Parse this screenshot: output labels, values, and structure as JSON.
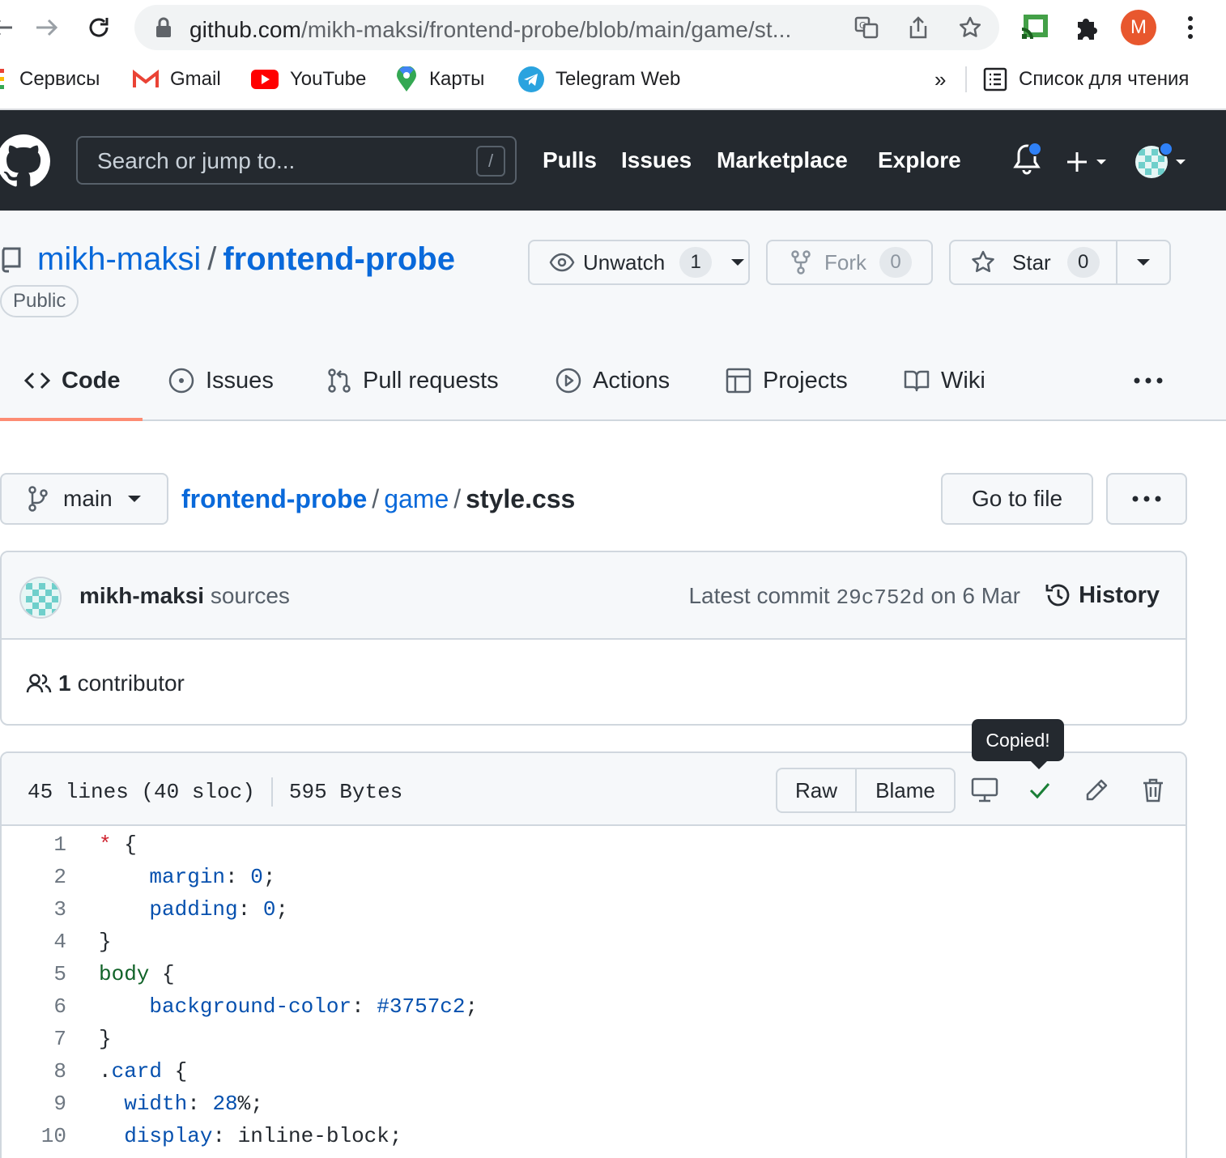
{
  "browser": {
    "url_host": "github.com",
    "url_path": "/mikh-maksi/frontend-probe/blob/main/game/st...",
    "profile_initial": "M",
    "bookmarks": [
      {
        "label": "Сервисы"
      },
      {
        "label": "Gmail"
      },
      {
        "label": "YouTube"
      },
      {
        "label": "Карты"
      },
      {
        "label": "Telegram Web"
      }
    ],
    "overflow_label": "»",
    "reading_list_label": "Список для чтения"
  },
  "github": {
    "search_placeholder": "Search or jump to...",
    "search_shortcut": "/",
    "nav": [
      "Pulls",
      "Issues",
      "Marketplace",
      "Explore"
    ]
  },
  "repo": {
    "owner": "mikh-maksi",
    "name": "frontend-probe",
    "visibility": "Public",
    "unwatch_label": "Unwatch",
    "watch_count": "1",
    "fork_label": "Fork",
    "fork_count": "0",
    "star_label": "Star",
    "star_count": "0",
    "tabs": [
      {
        "label": "Code",
        "active": true
      },
      {
        "label": "Issues"
      },
      {
        "label": "Pull requests"
      },
      {
        "label": "Actions"
      },
      {
        "label": "Projects"
      },
      {
        "label": "Wiki"
      }
    ]
  },
  "file_nav": {
    "branch": "main",
    "crumbs": [
      "frontend-probe",
      "game"
    ],
    "current_file": "style.css",
    "go_to_file": "Go to file"
  },
  "commit": {
    "author": "mikh-maksi",
    "message": "sources",
    "latest_label": "Latest commit",
    "sha": "29c752d",
    "date_text": "on 6 Mar",
    "history_label": "History",
    "contributors_count": "1",
    "contributors_label": "contributor"
  },
  "file": {
    "lines_info": "45 lines (40 sloc)",
    "size": "595 Bytes",
    "raw_label": "Raw",
    "blame_label": "Blame",
    "tooltip": "Copied!",
    "code_lines": [
      {
        "n": "1",
        "indent": "",
        "tokens": [
          {
            "t": "*",
            "c": "uni"
          },
          {
            "t": " {",
            "c": ""
          }
        ]
      },
      {
        "n": "2",
        "indent": "    ",
        "tokens": [
          {
            "t": "margin",
            "c": "prop"
          },
          {
            "t": ": ",
            "c": ""
          },
          {
            "t": "0",
            "c": "num"
          },
          {
            "t": ";",
            "c": ""
          }
        ]
      },
      {
        "n": "3",
        "indent": "    ",
        "tokens": [
          {
            "t": "padding",
            "c": "prop"
          },
          {
            "t": ": ",
            "c": ""
          },
          {
            "t": "0",
            "c": "num"
          },
          {
            "t": ";",
            "c": ""
          }
        ]
      },
      {
        "n": "4",
        "indent": "",
        "tokens": [
          {
            "t": "}",
            "c": ""
          }
        ]
      },
      {
        "n": "5",
        "indent": "",
        "tokens": [
          {
            "t": "body",
            "c": "sel"
          },
          {
            "t": " {",
            "c": ""
          }
        ]
      },
      {
        "n": "6",
        "indent": "    ",
        "tokens": [
          {
            "t": "background-color",
            "c": "prop"
          },
          {
            "t": ": ",
            "c": ""
          },
          {
            "t": "#3757c2",
            "c": "num"
          },
          {
            "t": ";",
            "c": ""
          }
        ]
      },
      {
        "n": "7",
        "indent": "",
        "tokens": [
          {
            "t": "}",
            "c": ""
          }
        ]
      },
      {
        "n": "8",
        "indent": "",
        "tokens": [
          {
            "t": ".",
            "c": ""
          },
          {
            "t": "card",
            "c": "prop"
          },
          {
            "t": " {",
            "c": ""
          }
        ]
      },
      {
        "n": "9",
        "indent": "  ",
        "tokens": [
          {
            "t": "width",
            "c": "prop"
          },
          {
            "t": ": ",
            "c": ""
          },
          {
            "t": "28",
            "c": "num"
          },
          {
            "t": "%;",
            "c": ""
          }
        ]
      },
      {
        "n": "10",
        "indent": "  ",
        "tokens": [
          {
            "t": "display",
            "c": "prop"
          },
          {
            "t": ": inline-block;",
            "c": ""
          }
        ]
      }
    ]
  },
  "colors": {
    "header_bg": "#24292f",
    "link": "#0969da",
    "tab_underline": "#fd8c73",
    "check_green": "#1a7f37",
    "notification_dot": "#2f81f7",
    "profile_bg": "#e8572e"
  }
}
